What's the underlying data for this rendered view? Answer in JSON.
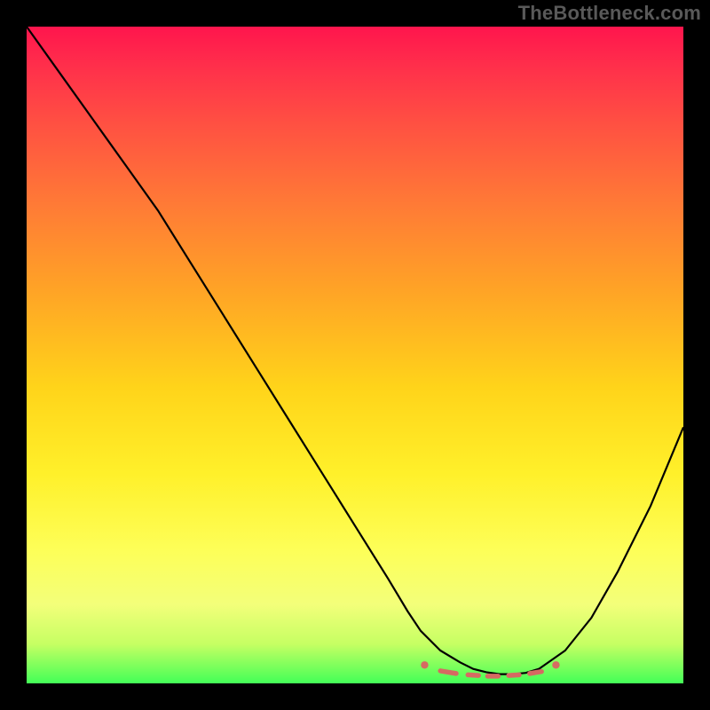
{
  "watermark_text": "TheBottleneck.com",
  "colors": {
    "background_page": "#000000",
    "watermark": "#595959",
    "curve": "#000000",
    "marker": "#d66a62",
    "gradient_top": "#ff154d",
    "gradient_bottom": "#43ff57"
  },
  "chart_data": {
    "type": "line",
    "title": "",
    "xlabel": "",
    "ylabel": "",
    "xlim": [
      0,
      100
    ],
    "ylim": [
      0,
      100
    ],
    "x": [
      0,
      5,
      10,
      15,
      20,
      25,
      30,
      35,
      40,
      45,
      50,
      55,
      58,
      60,
      63,
      66,
      68,
      70,
      72,
      74,
      76,
      78,
      82,
      86,
      90,
      95,
      100
    ],
    "values": [
      100,
      93,
      86,
      79,
      72,
      64,
      56,
      48,
      40,
      32,
      24,
      16,
      11,
      8,
      5,
      3.2,
      2.2,
      1.7,
      1.4,
      1.4,
      1.6,
      2.2,
      5,
      10,
      17,
      27,
      39
    ],
    "markers": {
      "dashes": [
        {
          "x1": 63.0,
          "y1": 1.9,
          "x2": 65.4,
          "y2": 1.5
        },
        {
          "x1": 67.2,
          "y1": 1.3,
          "x2": 68.8,
          "y2": 1.2
        },
        {
          "x1": 70.2,
          "y1": 1.1,
          "x2": 71.8,
          "y2": 1.1
        },
        {
          "x1": 73.4,
          "y1": 1.2,
          "x2": 75.0,
          "y2": 1.3
        },
        {
          "x1": 76.6,
          "y1": 1.5,
          "x2": 78.4,
          "y2": 1.8
        }
      ],
      "dots": [
        {
          "x": 60.6,
          "y": 2.8
        },
        {
          "x": 80.6,
          "y": 2.8
        }
      ]
    }
  }
}
